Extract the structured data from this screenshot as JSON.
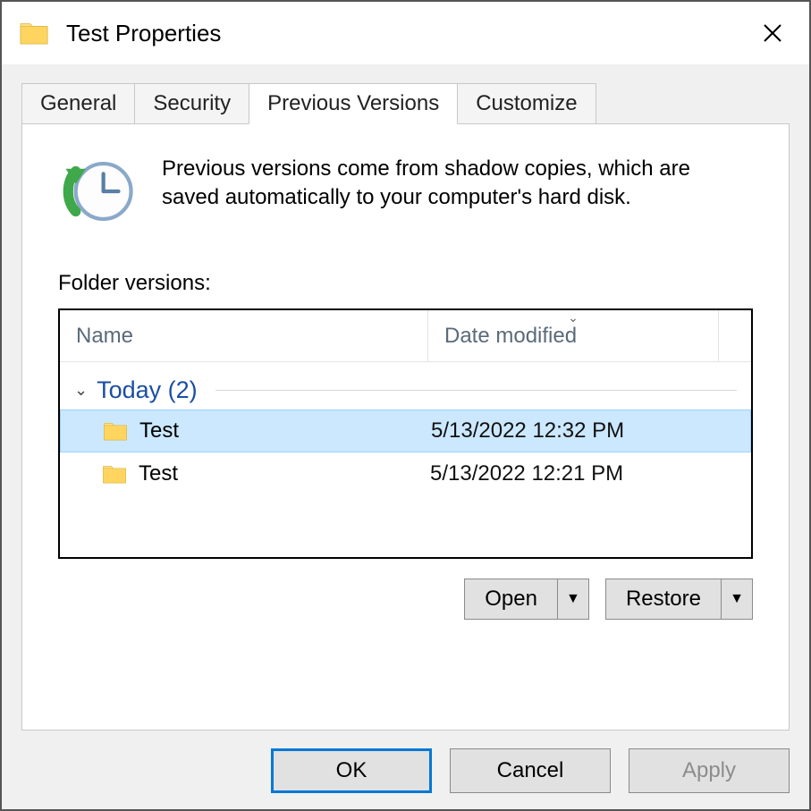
{
  "window": {
    "title": "Test Properties"
  },
  "tabs": {
    "general": "General",
    "security": "Security",
    "previous_versions": "Previous Versions",
    "customize": "Customize"
  },
  "panel": {
    "info_text": "Previous versions come from shadow copies, which are saved automatically to your computer's hard disk.",
    "folder_versions_label": "Folder versions:",
    "columns": {
      "name": "Name",
      "date": "Date modified"
    },
    "group": {
      "label": "Today (2)"
    },
    "rows": [
      {
        "name": "Test",
        "date": "5/13/2022 12:32 PM",
        "selected": true
      },
      {
        "name": "Test",
        "date": "5/13/2022 12:21 PM",
        "selected": false
      }
    ],
    "buttons": {
      "open": "Open",
      "restore": "Restore"
    }
  },
  "dialog": {
    "ok": "OK",
    "cancel": "Cancel",
    "apply": "Apply"
  }
}
